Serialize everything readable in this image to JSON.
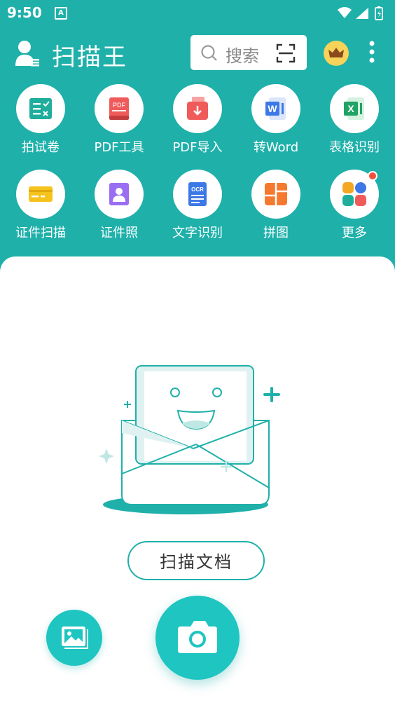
{
  "status_bar": {
    "time": "9:50",
    "notif_letter": "A"
  },
  "header": {
    "title": "扫描王",
    "search_placeholder": "搜索"
  },
  "tools": [
    {
      "label": "拍试卷",
      "icon": "exam-icon"
    },
    {
      "label": "PDF工具",
      "icon": "pdf-book-icon",
      "icon_text": "PDF"
    },
    {
      "label": "PDF导入",
      "icon": "pdf-import-icon"
    },
    {
      "label": "转Word",
      "icon": "word-icon",
      "icon_text": "W"
    },
    {
      "label": "表格识别",
      "icon": "excel-icon",
      "icon_text": "X"
    },
    {
      "label": "证件扫描",
      "icon": "id-card-icon"
    },
    {
      "label": "证件照",
      "icon": "id-photo-icon"
    },
    {
      "label": "文字识别",
      "icon": "ocr-icon",
      "icon_text": "OCR"
    },
    {
      "label": "拼图",
      "icon": "collage-icon"
    },
    {
      "label": "更多",
      "icon": "more-apps-icon"
    }
  ],
  "main": {
    "scan_button_label": "扫描文档"
  },
  "colors": {
    "brand": "#1fb0aa",
    "accent": "#1fc5c0",
    "badge_red": "#f0503c"
  }
}
